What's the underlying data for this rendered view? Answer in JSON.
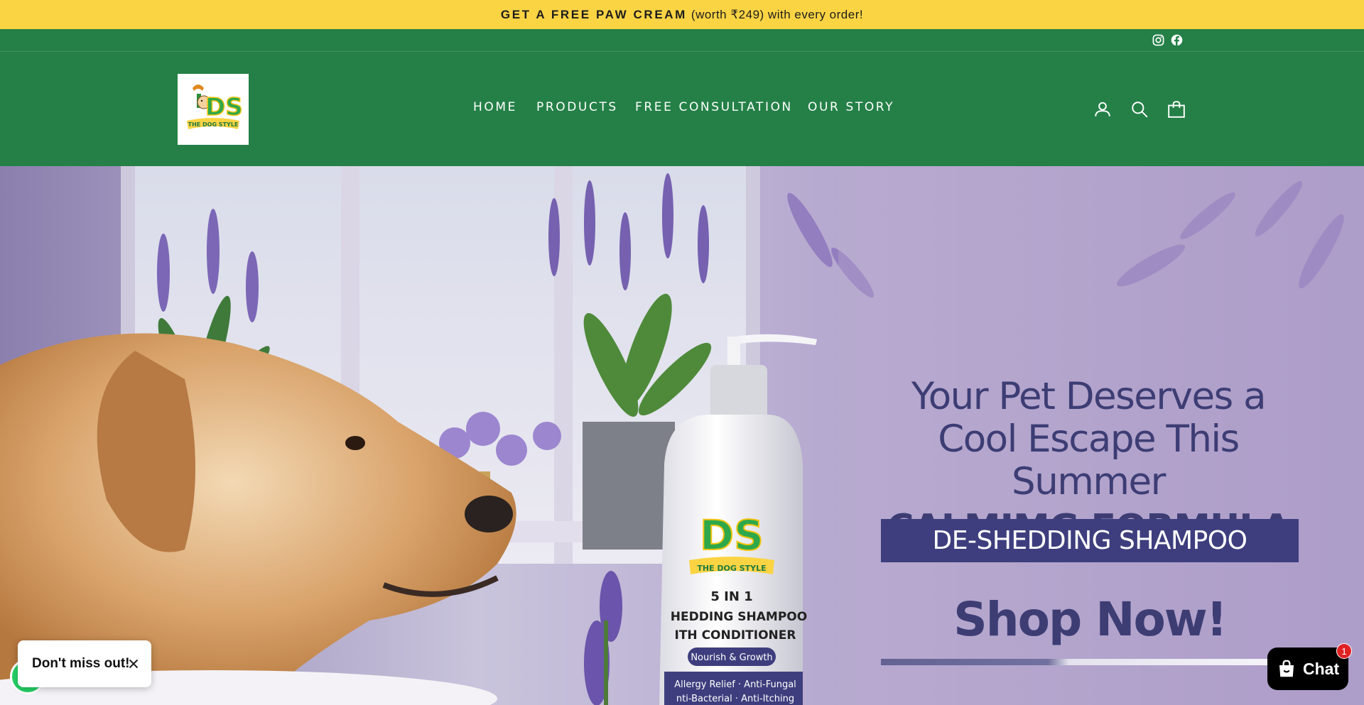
{
  "announcement": {
    "strong_text": "GET A FREE PAW CREAM",
    "rest_text": "(worth ₹249) with every order!"
  },
  "social": {
    "icons": [
      "instagram-icon",
      "facebook-icon"
    ]
  },
  "header": {
    "logo": {
      "letters": "DS",
      "tagline": "THE DOG STYLE"
    },
    "nav": [
      {
        "label": "HOME"
      },
      {
        "label": "PRODUCTS"
      },
      {
        "label": "FREE CONSULTATION"
      },
      {
        "label": "OUR STORY"
      }
    ],
    "icons": [
      "account-icon",
      "search-icon",
      "cart-icon"
    ]
  },
  "hero": {
    "headline_line1": "Your Pet Deserves a",
    "headline_line2": "Cool Escape This Summer",
    "formula": "CALMIMG FORMULA",
    "product": "DE-SHEDDING SHAMPOO",
    "cta": "Shop Now!",
    "bottle": {
      "brand": "THE DOG STYLE",
      "line1": "5 IN 1",
      "line2": "HEDDING SHAMPOO",
      "line3": "ITH CONDITIONER",
      "tagline": "Nourish & Growth",
      "benefits1": "Allergy Relief · Anti-Fungal",
      "benefits2": "nti-Bacterial · Anti-Itching"
    }
  },
  "popup": {
    "label": "Don't miss out!"
  },
  "chat": {
    "label": "Chat",
    "badge": "1"
  },
  "colors": {
    "announcement_bg": "#fbd444",
    "header_bg": "#248047",
    "hero_text": "#3d3d74",
    "band_bg": "#3e3e7e"
  }
}
